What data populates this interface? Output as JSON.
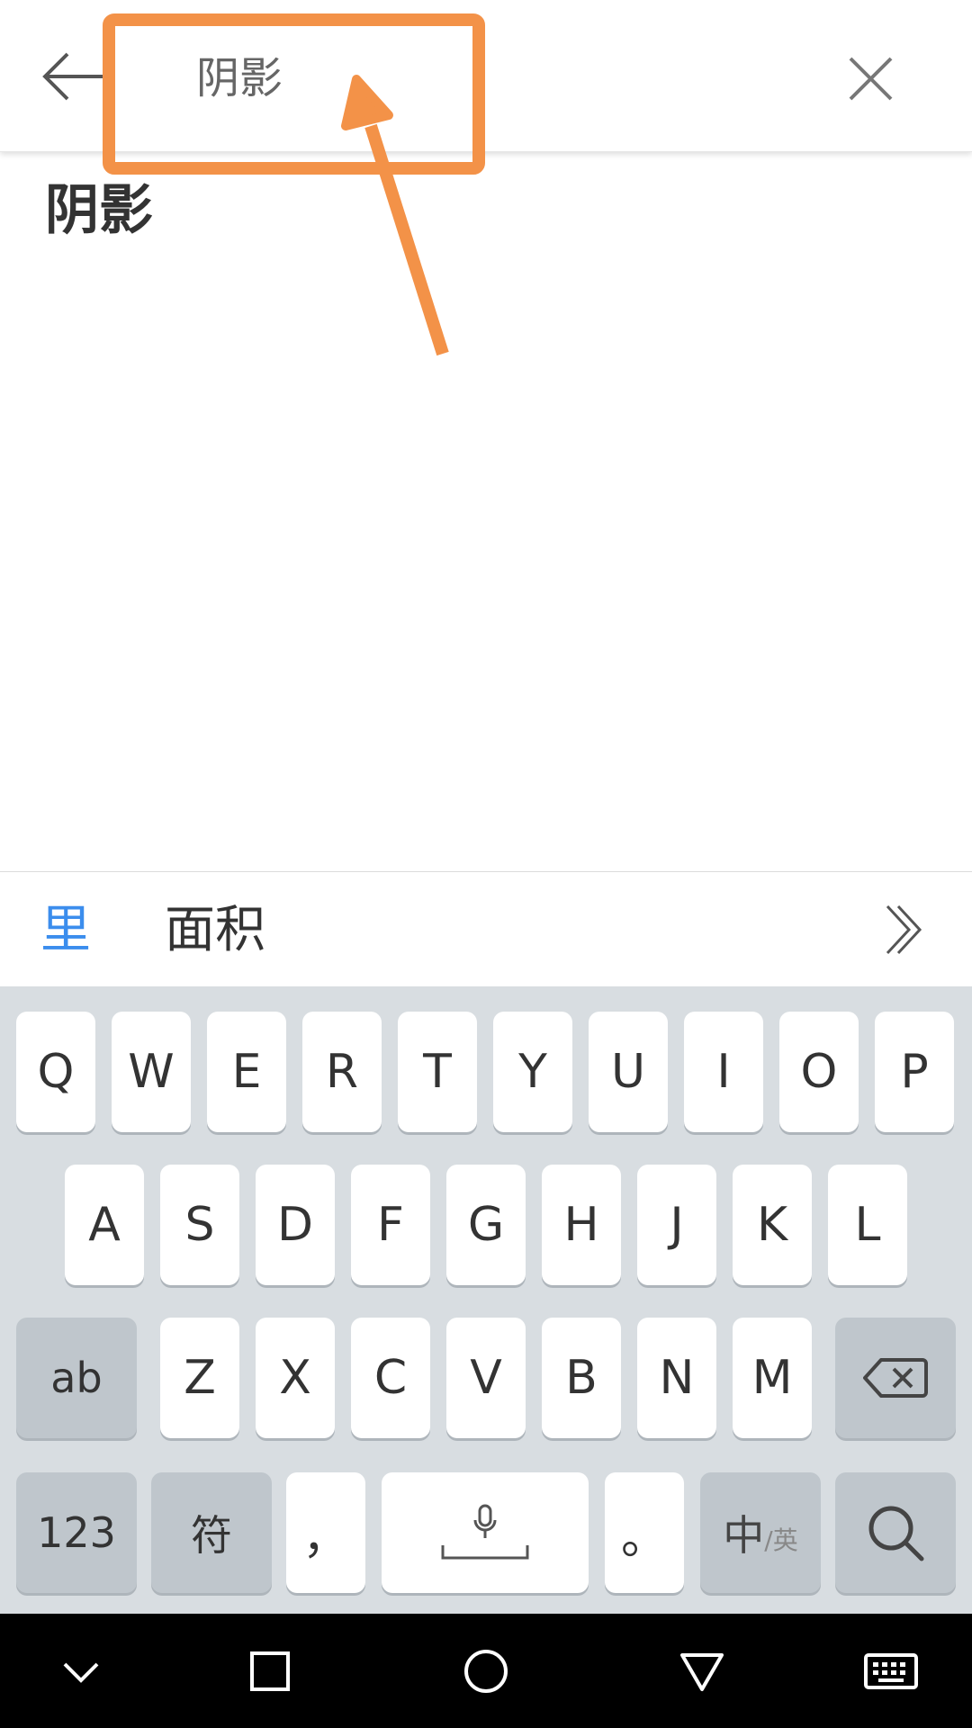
{
  "search": {
    "query": "阴影"
  },
  "result": {
    "title": "阴影"
  },
  "candidates": {
    "items": [
      "里",
      "面积"
    ],
    "highlight_color": "#3b8ded"
  },
  "keyboard": {
    "row1": [
      "Q",
      "W",
      "E",
      "R",
      "T",
      "Y",
      "U",
      "I",
      "O",
      "P"
    ],
    "row2": [
      "A",
      "S",
      "D",
      "F",
      "G",
      "H",
      "J",
      "K",
      "L"
    ],
    "row3_letters": [
      "Z",
      "X",
      "C",
      "V",
      "B",
      "N",
      "M"
    ],
    "shift_label": "ab",
    "num_label": "123",
    "symbol_label": "符",
    "comma_label": "，",
    "period_label": "。",
    "lang_label_main": "中",
    "lang_label_alt": "/英"
  },
  "icons": {
    "back": "arrow-left-icon",
    "clear": "close-icon",
    "more": "double-chevron-right-icon",
    "backspace": "backspace-icon",
    "mic": "microphone-icon",
    "search": "search-icon",
    "nav": [
      "chevron-down-icon",
      "square-icon",
      "circle-icon",
      "triangle-icon",
      "keyboard-icon"
    ]
  },
  "annotation_color": "#f39248"
}
